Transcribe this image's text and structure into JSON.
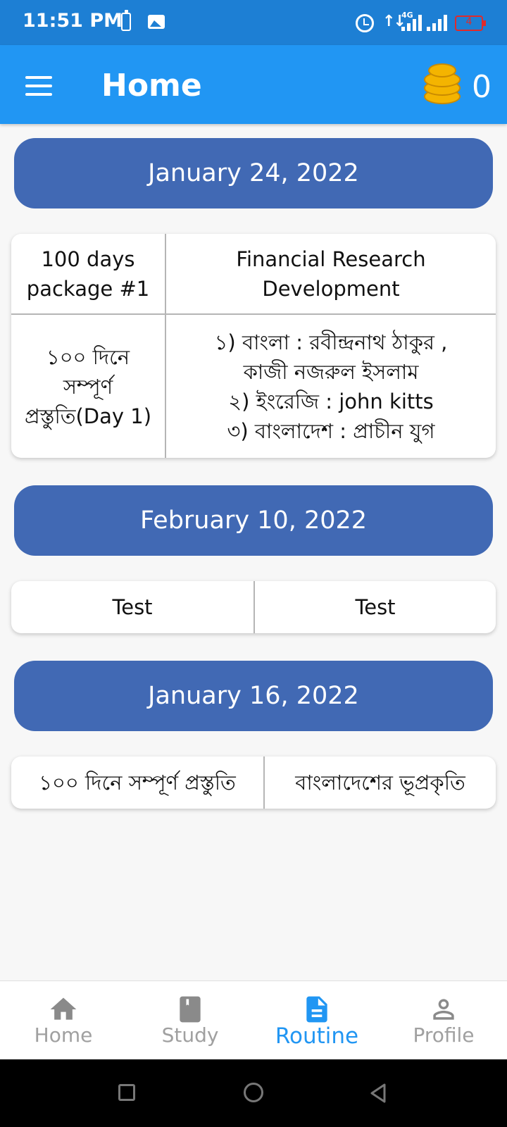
{
  "status_bar": {
    "time": "11:51 PM",
    "network": "4G",
    "battery_level": "4",
    "battery_color": "#e02a2a"
  },
  "app_bar": {
    "title": "Home",
    "coin_count": "0",
    "background": "#2196f3",
    "icons": [
      "menu-icon",
      "coins-icon"
    ]
  },
  "routine": [
    {
      "date": "January 24, 2022",
      "rows": [
        {
          "left": "100 days\npackage #1",
          "right": "Financial Research\nDevelopment"
        },
        {
          "left": "১০০ দিনে\nসম্পূর্ণ\nপ্রস্তুতি(Day 1)",
          "right": "১) বাংলা : রবীন্দ্রনাথ ঠাকুর ,\nকাজী নজরুল ইসলাম\n২) ইংরেজি : john kitts\n৩) বাংলাদেশ : প্রাচীন যুগ"
        }
      ]
    },
    {
      "date": "February 10, 2022",
      "rows": [
        {
          "left": "Test",
          "right": "Test"
        }
      ]
    },
    {
      "date": "January 16, 2022",
      "rows": [
        {
          "left": "১০০ দিনে সম্পূর্ণ প্রস্তুতি",
          "right": "বাংলাদেশের ভূপ্রকৃতি"
        }
      ]
    }
  ],
  "bottom_nav": {
    "items": [
      {
        "label": "Home",
        "icon": "home-icon",
        "active": false
      },
      {
        "label": "Study",
        "icon": "book-icon",
        "active": false
      },
      {
        "label": "Routine",
        "icon": "document-icon",
        "active": true
      },
      {
        "label": "Profile",
        "icon": "person-icon",
        "active": false
      }
    ],
    "active_color": "#2196f3",
    "inactive_color": "#a0a0a0"
  },
  "system_nav": {
    "icons": [
      "recent-apps-icon",
      "home-circle-icon",
      "back-icon"
    ]
  },
  "colors": {
    "date_header": "#4169b4",
    "status_bar": "#1d7fd4"
  }
}
